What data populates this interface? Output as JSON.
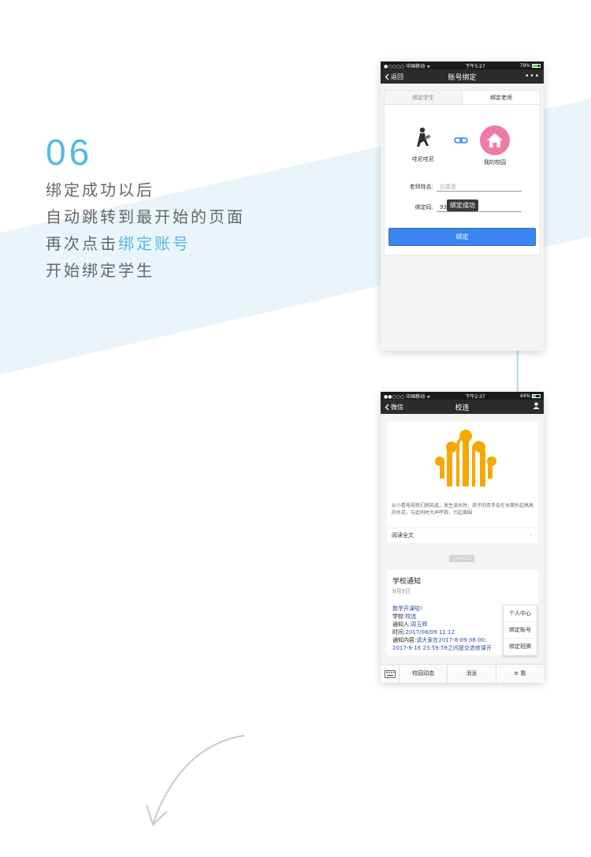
{
  "step": {
    "number": "06",
    "line1": "绑定成功以后",
    "line2": "自动跳转到最开始的页面",
    "line3_prefix": "再次点击",
    "line3_highlight": "绑定账号",
    "line4": "开始绑定学生"
  },
  "colors": {
    "accent": "#55b8e6",
    "button": "#3b86f0",
    "pink": "#f07aa6",
    "logo": "#f5a800"
  },
  "phone1": {
    "status": {
      "carrier": "●○○○○ 中国移动 ᯤ",
      "time": "下午5:27",
      "battery": "79%"
    },
    "nav": {
      "back": "返回",
      "title": "账号绑定",
      "more": "•••"
    },
    "tabs": [
      "绑定学生",
      "绑定老师"
    ],
    "active_tab": "绑定老师",
    "left_avatar_label": "哇尼哇尼",
    "right_avatar_label": "我的校园",
    "teacher_name_label": "老师姓名:",
    "teacher_name_value": "白露思",
    "code_label": "绑定码:",
    "code_value": "93",
    "toast": "绑定成功",
    "submit": "绑定"
  },
  "phone2": {
    "status": {
      "carrier": "●●○○○ 中国移动 ᯤ",
      "time": "下午2:37",
      "battery": "44%"
    },
    "nav": {
      "back": "微信",
      "title": "校连"
    },
    "article_text": "从小看电视我们就知道，发生溺水时，孩子的双手会在水面扑起高高的水花，与此同时大声呼救，引起周围",
    "read_all": "阅读全文",
    "time_chip": "上午11:12",
    "notice": {
      "title": "学校通知",
      "date": "8月9日",
      "headline": "数学开课啦!",
      "school_label": "学校:",
      "school_value": "校连",
      "notifier_label": "通知人:",
      "notifier_value": "周玉辉",
      "time_label": "时间:",
      "time_value": "2017/08/09 11:12",
      "content_label": "通知内容:",
      "content_value": "请大家在2017-8-09 08:00:",
      "content_value2": "2017-8-16 23:59:59之间提交选修课开"
    },
    "menu": [
      "个人中心",
      "绑定账号",
      "绑定班牌"
    ],
    "tabbar": [
      "校园动态",
      "消息",
      "≡ 我"
    ]
  }
}
